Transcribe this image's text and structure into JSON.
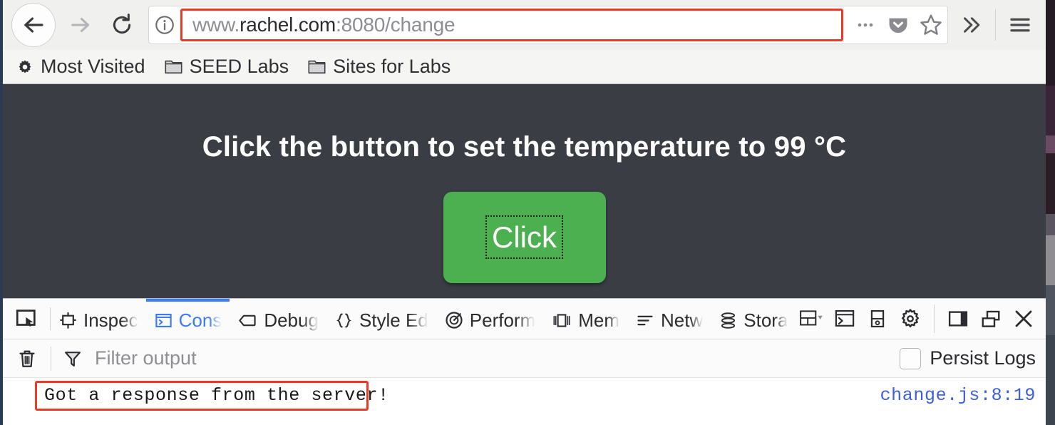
{
  "browser": {
    "nav": {
      "back_icon": "arrow-left-icon",
      "forward_icon": "arrow-right-icon",
      "reload_icon": "reload-icon",
      "identity_icon": "info-circle-icon",
      "url_prefix": "www.",
      "url_host": "rachel.com",
      "url_path": ":8080/change",
      "url_full": "www.rachel.com:8080/change",
      "page_actions_icon": "ellipsis-icon",
      "pocket_icon": "pocket-icon",
      "bookmark_icon": "star-icon",
      "overflow_icon": "double-chevron-right-icon",
      "menu_icon": "hamburger-menu-icon"
    },
    "bookmarks": [
      {
        "label": "Most Visited",
        "icon": "gear-icon"
      },
      {
        "label": "SEED Labs",
        "icon": "folder-icon"
      },
      {
        "label": "Sites for Labs",
        "icon": "folder-icon"
      }
    ]
  },
  "page": {
    "heading": "Click the button to set the temperature to 99 °C",
    "button_label": "Click",
    "background_color": "#3b3d45",
    "button_color": "#4caf50"
  },
  "devtools": {
    "picker_icon": "element-picker-icon",
    "tabs": [
      {
        "label": "Inspec",
        "icon": "inspector-icon",
        "active": false
      },
      {
        "label": "Cons",
        "icon": "console-icon",
        "active": true
      },
      {
        "label": "Debug",
        "icon": "debugger-icon",
        "active": false
      },
      {
        "label": "Style Ed",
        "icon": "style-editor-icon",
        "active": false
      },
      {
        "label": "Perform",
        "icon": "performance-icon",
        "active": false
      },
      {
        "label": "Mem",
        "icon": "memory-icon",
        "active": false
      },
      {
        "label": "Netw",
        "icon": "network-icon",
        "active": false
      },
      {
        "label": "Stora",
        "icon": "storage-icon",
        "active": false
      }
    ],
    "right_buttons": [
      {
        "icon": "responsive-design-mode-icon"
      },
      {
        "icon": "split-console-icon"
      },
      {
        "icon": "screenshot-icon"
      },
      {
        "icon": "settings-gear-icon"
      },
      {
        "icon": "dock-to-side-icon"
      },
      {
        "icon": "separate-window-icon"
      },
      {
        "icon": "close-icon"
      }
    ],
    "console": {
      "clear_icon": "trash-icon",
      "filter_icon": "funnel-icon",
      "filter_placeholder": "Filter output",
      "filter_value": "",
      "persist_logs_label": "Persist Logs",
      "persist_logs_checked": false,
      "rows": [
        {
          "message": "Got a response from the server!",
          "source": "change.js:8:19"
        }
      ]
    }
  },
  "annotations": {
    "highlight_color": "#ec3a25",
    "boxes": [
      {
        "target": "url-text-box"
      },
      {
        "target": "console-message-row"
      }
    ]
  }
}
